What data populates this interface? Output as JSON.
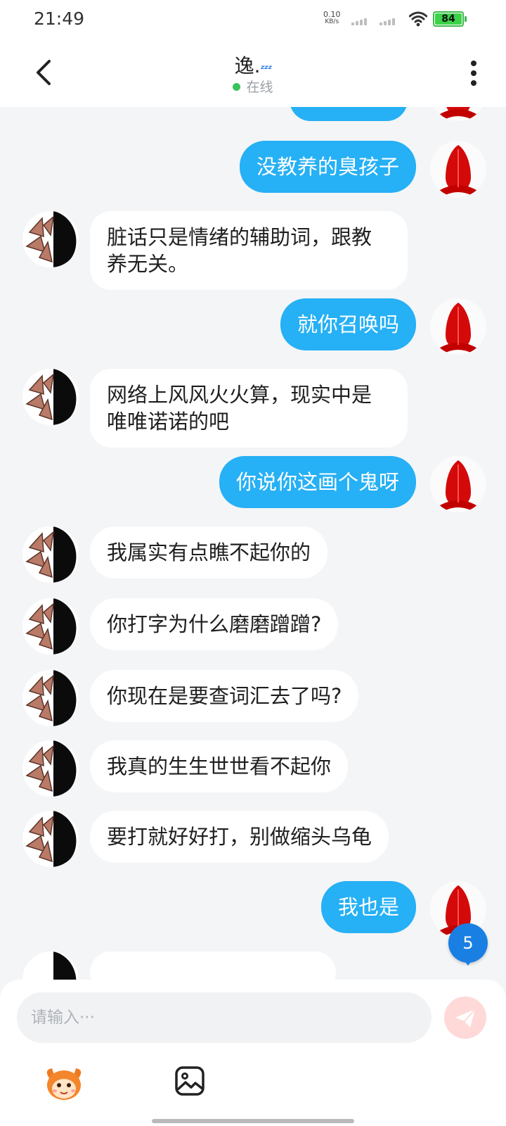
{
  "status_bar": {
    "time": "21:49",
    "net_speed": "0.10",
    "net_unit": "KB/s",
    "battery": "84"
  },
  "header": {
    "title": "逸.",
    "status": "在线"
  },
  "messages": [
    {
      "side": "out",
      "text": "没教养的臭孩子"
    },
    {
      "side": "in",
      "text": "脏话只是情绪的辅助词，跟教养无关。"
    },
    {
      "side": "out",
      "text": "就你召唤吗"
    },
    {
      "side": "in",
      "text": "网络上风风火火算，现实中是唯唯诺诺的吧"
    },
    {
      "side": "out",
      "text": "你说你这画个鬼呀"
    },
    {
      "side": "in",
      "text": "我属实有点瞧不起你的"
    },
    {
      "side": "in",
      "text": "你打字为什么磨磨蹭蹭?"
    },
    {
      "side": "in",
      "text": "你现在是要查词汇去了吗?"
    },
    {
      "side": "in",
      "text": "我真的生生世世看不起你"
    },
    {
      "side": "in",
      "text": "要打就好好打，别做缩头乌龟"
    },
    {
      "side": "out",
      "text": "我也是"
    }
  ],
  "unread_badge": "5",
  "input": {
    "placeholder": "请输入···",
    "value": ""
  },
  "colors": {
    "outgoing_bubble": "#26b0f5",
    "incoming_bubble": "#ffffff",
    "online_dot": "#37c45a",
    "badge": "#1a7fe3"
  },
  "icons": [
    "back-arrow-icon",
    "more-vertical-icon",
    "send-icon",
    "emoji-mascot-icon",
    "image-icon",
    "wifi-icon",
    "signal-icon",
    "battery-icon"
  ]
}
